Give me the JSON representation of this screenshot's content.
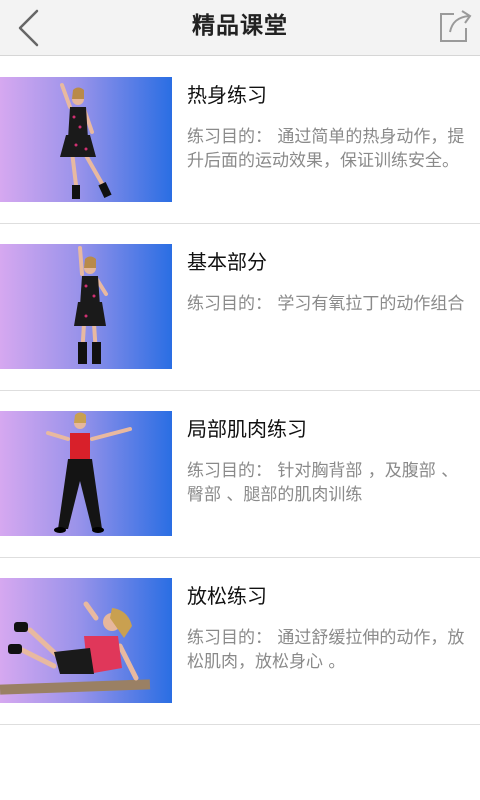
{
  "header": {
    "title": "精品课堂",
    "back_icon": "chevron-left-icon",
    "share_icon": "share-icon"
  },
  "colors": {
    "thumb_gradient_start": "#d6a8f0",
    "thumb_gradient_end": "#2a6ee3"
  },
  "lessons": [
    {
      "title": "热身练习",
      "desc": "练习目的： 通过简单的热身动作，提升后面的运动效果，保证训练安全。"
    },
    {
      "title": "基本部分",
      "desc": "练习目的： 学习有氧拉丁的动作组合"
    },
    {
      "title": "局部肌肉练习",
      "desc": "练习目的： 针对胸背部 ，及腹部 、臀部 、腿部的肌肉训练"
    },
    {
      "title": "放松练习",
      "desc": "练习目的： 通过舒缓拉伸的动作，放松肌肉，放松身心 。"
    }
  ]
}
